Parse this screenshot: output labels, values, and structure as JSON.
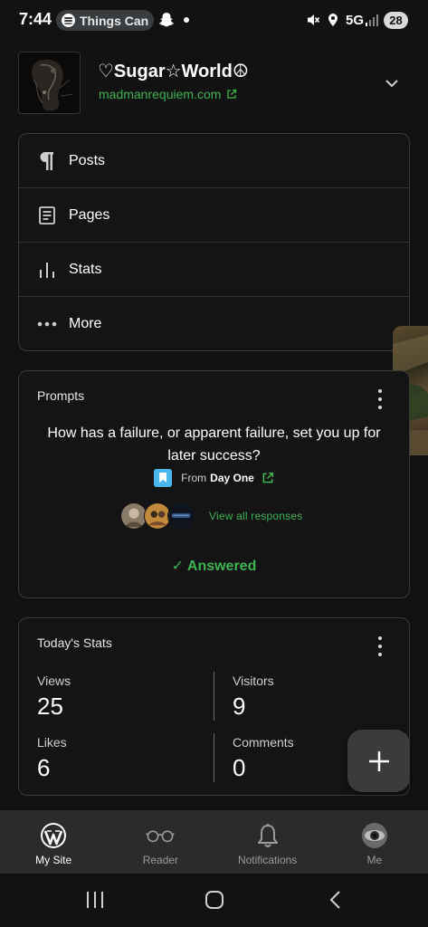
{
  "status_bar": {
    "time": "7:44",
    "media_pill_text": "Things Can",
    "network": "5G",
    "battery": "28"
  },
  "site": {
    "title": "♡Sugar☆World☮",
    "url": "madmanrequiem.com"
  },
  "menu": {
    "items": [
      {
        "label": "Posts",
        "icon": "paragraph-icon"
      },
      {
        "label": "Pages",
        "icon": "page-icon"
      },
      {
        "label": "Stats",
        "icon": "stats-bars-icon"
      },
      {
        "label": "More",
        "icon": "more-dots-icon"
      }
    ]
  },
  "prompts": {
    "title": "Prompts",
    "question": "How has a failure, or apparent failure, set you up for later success?",
    "from_prefix": "From",
    "from_source": "Day One",
    "view_all": "View all responses",
    "answered": "✓ Answered"
  },
  "stats": {
    "title": "Today's Stats",
    "views_label": "Views",
    "views_value": "25",
    "visitors_label": "Visitors",
    "visitors_value": "9",
    "likes_label": "Likes",
    "likes_value": "6",
    "comments_label": "Comments",
    "comments_value": "0"
  },
  "bottom_nav": {
    "items": [
      {
        "label": "My Site",
        "icon": "wordpress-icon",
        "active": true
      },
      {
        "label": "Reader",
        "icon": "glasses-icon",
        "active": false
      },
      {
        "label": "Notifications",
        "icon": "bell-icon",
        "active": false
      },
      {
        "label": "Me",
        "icon": "profile-avatar",
        "active": false
      }
    ]
  },
  "colors": {
    "accent_green": "#3cb452",
    "background": "#121212",
    "card_border": "#3a3a3a"
  }
}
